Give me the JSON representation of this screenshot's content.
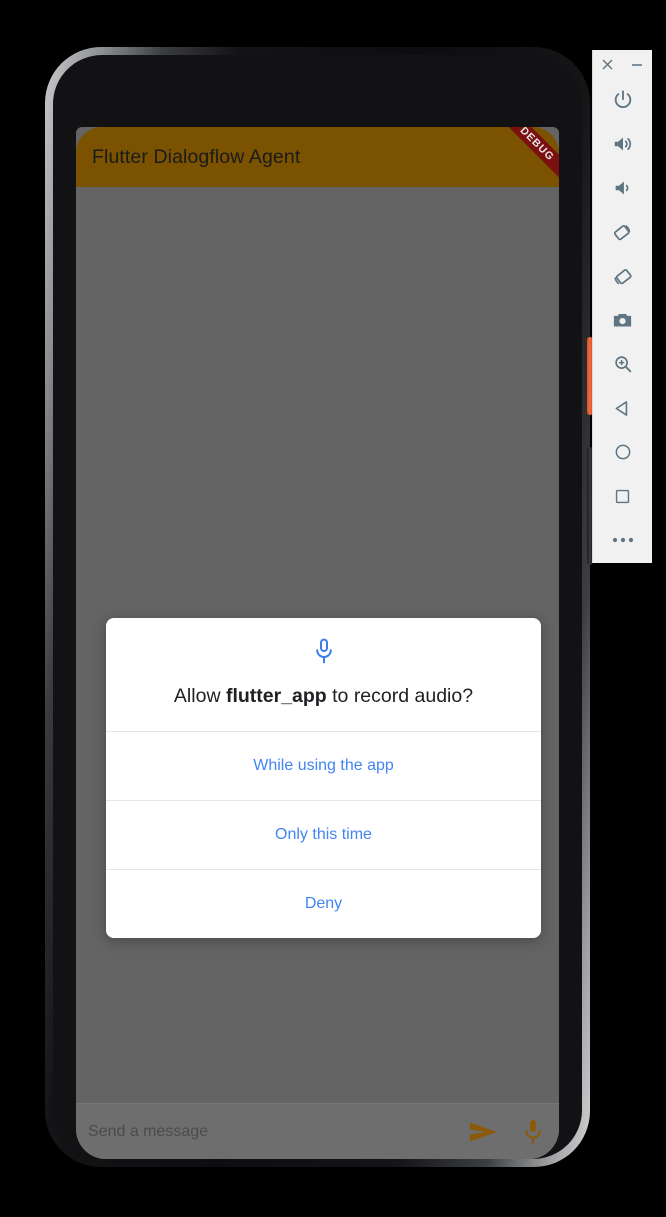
{
  "app": {
    "title": "Flutter Dialogflow Agent",
    "debug_banner": "DEBUG",
    "appbar_color": "#7a5200",
    "accent_color": "#7a5200",
    "body_color": "#646464"
  },
  "dialog": {
    "icon": "microphone-icon",
    "icon_color": "#3b7ded",
    "message_prefix": "Allow ",
    "message_app": "flutter_app",
    "message_suffix": " to record audio?",
    "button_color": "#4285f4",
    "buttons": [
      {
        "label": "While using the app",
        "name": "while-using-the-app-button"
      },
      {
        "label": "Only this time",
        "name": "only-this-time-button"
      },
      {
        "label": "Deny",
        "name": "deny-button"
      }
    ]
  },
  "message_bar": {
    "placeholder": "Send a message",
    "send_icon": "send-icon",
    "mic_icon": "microphone-icon",
    "icon_color": "#8a5a09"
  },
  "emulator_toolbar": {
    "window_controls": [
      {
        "label": "×",
        "name": "close-window-button"
      },
      {
        "label": "−",
        "name": "minimize-window-button"
      }
    ],
    "items": [
      {
        "name": "power-button",
        "icon": "power-icon"
      },
      {
        "name": "volume-up-button",
        "icon": "volume-up-icon"
      },
      {
        "name": "volume-down-button",
        "icon": "volume-down-icon"
      },
      {
        "name": "rotate-left-button",
        "icon": "rotate-left-icon"
      },
      {
        "name": "rotate-right-button",
        "icon": "rotate-right-icon"
      },
      {
        "name": "screenshot-button",
        "icon": "camera-icon"
      },
      {
        "name": "zoom-button",
        "icon": "zoom-in-icon"
      },
      {
        "name": "back-button",
        "icon": "triangle-back-icon"
      },
      {
        "name": "home-button",
        "icon": "circle-home-icon"
      },
      {
        "name": "overview-button",
        "icon": "square-overview-icon"
      },
      {
        "name": "extended-controls-button",
        "icon": "more-dots-icon"
      }
    ],
    "icon_color": "#5f7582"
  }
}
